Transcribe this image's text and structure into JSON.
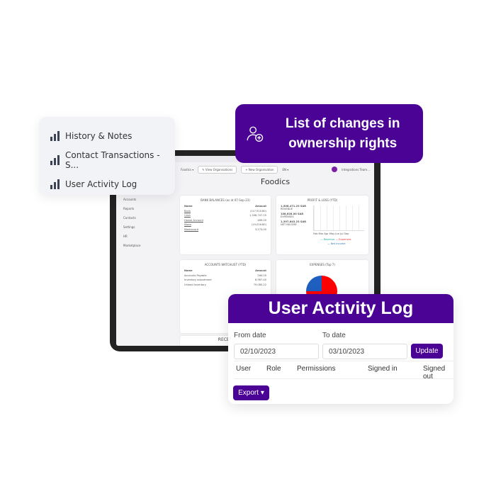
{
  "history_card": {
    "items": [
      {
        "label": "History & Notes"
      },
      {
        "label": "Contact Transactions - S..."
      },
      {
        "label": "User Activity Log"
      }
    ]
  },
  "promo": {
    "title": "List of changes in ownership rights",
    "icon": "user-plus-icon"
  },
  "app": {
    "nav": {
      "org": "Foodics ▾",
      "view_orgs": "✎ View Organisations",
      "new_org": "+ New Organisation",
      "lang": "EN ▾",
      "user": "Integrations Team..."
    },
    "sidebar": [
      "Accounts",
      "Reports",
      "Contacts",
      "Settings",
      "HR",
      "Marketplace"
    ],
    "title": "Foodics",
    "bank": {
      "title": "BANK BALANCES (as at 07-Sep-23)",
      "name_h": "Name",
      "amount_h": "Amount",
      "rows": [
        [
          "Bank",
          "(117,915.80)"
        ],
        [
          "Cash",
          "1,308,707.15"
        ],
        [
          "House Account",
          "489.00"
        ],
        [
          "Mada",
          "(19,016.80)"
        ],
        [
          "Mastercard",
          "3,273.00"
        ]
      ]
    },
    "pl": {
      "title": "PROFIT & LOSS (YTD)",
      "revenue": "1,506,471.23 SAR",
      "revenue_l": "REVENUE",
      "expenses": "108,628.00 SAR",
      "expenses_l": "EXPENSES",
      "net": "1,397,843.23 SAR",
      "net_l": "NET INCOME",
      "months": "Feb Mar Apr May Jun Jul Sep",
      "legend1": "— Revenue",
      "legend2": "— Expenses",
      "legend3": "— Net Income"
    },
    "watch": {
      "title": "ACCOUNTS WATCHLIST (YTD)",
      "name_h": "Name",
      "amount_h": "Amount",
      "rows": [
        [
          "Accounts Payable",
          "260.00"
        ],
        [
          "Inventory adjustment",
          "8,967.40"
        ],
        [
          "Unlead Inventory",
          "79,085.22"
        ]
      ]
    },
    "expenses": {
      "title": "EXPENSES (Top 7)",
      "colors": [
        "#ff0000",
        "#1f5fbf"
      ]
    },
    "recent": "RECEN"
  },
  "log": {
    "title": "User Activity Log",
    "from_label": "From date",
    "from": "02/10/2023",
    "to_label": "To date",
    "to": "03/10/2023",
    "update": "Update",
    "columns": [
      "User",
      "Role",
      "Permissions",
      "Signed in",
      "Signed out"
    ],
    "export": "Export ▾"
  },
  "colors": {
    "brand": "#4b0396"
  }
}
